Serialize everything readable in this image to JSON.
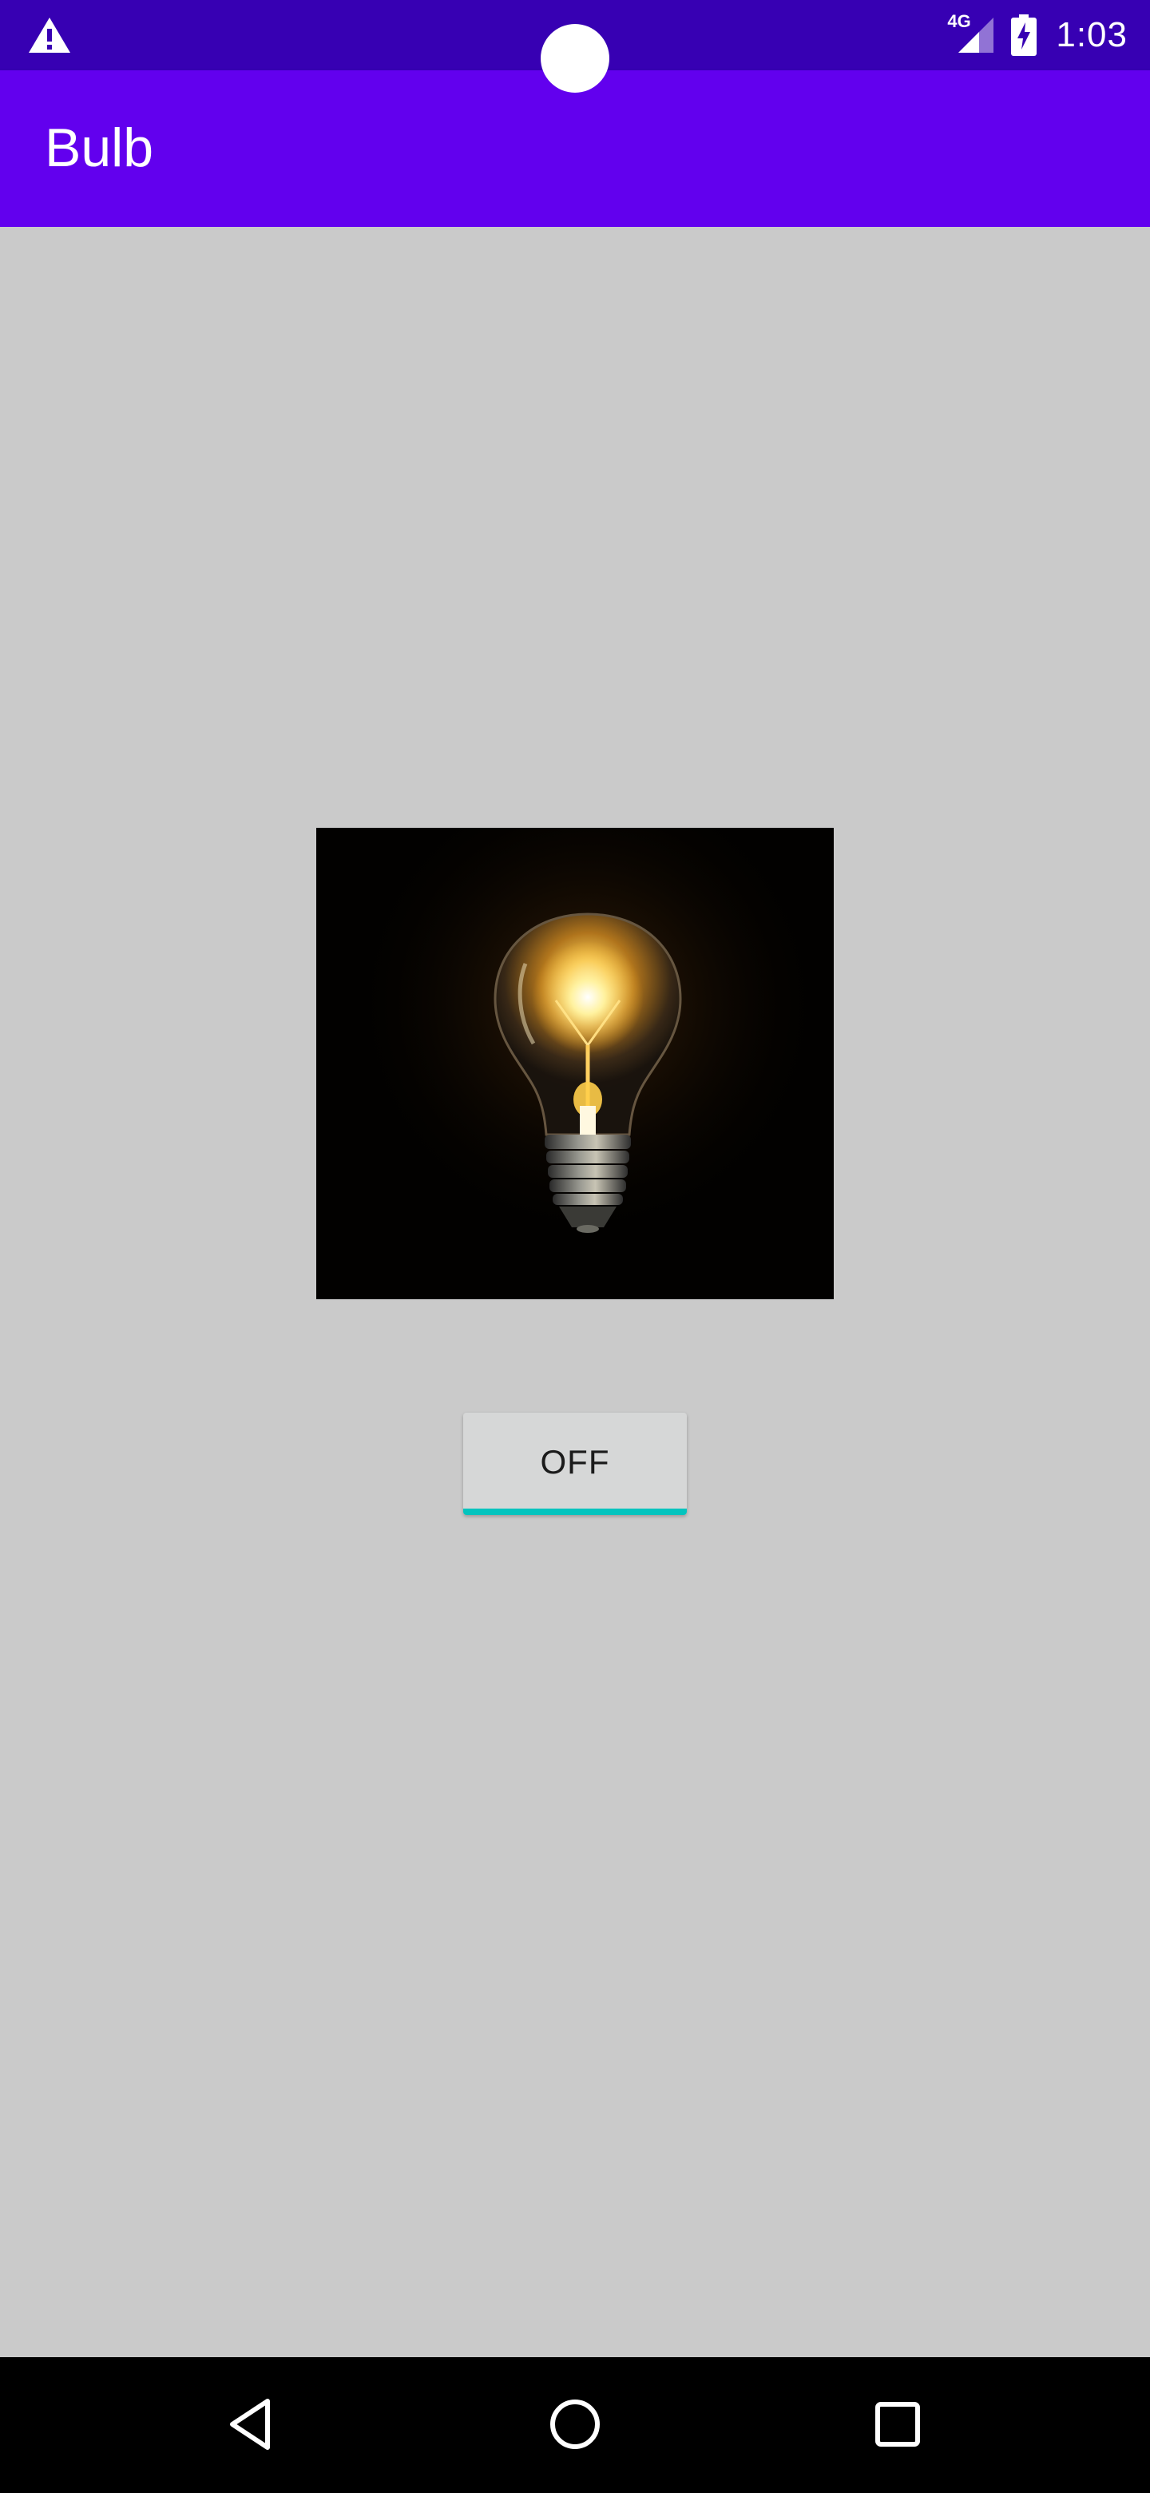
{
  "status_bar": {
    "time": "1:03",
    "network_label": "4G",
    "icons": [
      "warning-icon",
      "signal-icon",
      "battery-charging-icon"
    ]
  },
  "app_bar": {
    "title": "Bulb"
  },
  "main": {
    "bulb_image": {
      "icon": "light-bulb-image",
      "state": "on"
    },
    "toggle_button": {
      "label": "OFF",
      "accent_color": "#03c4be"
    }
  },
  "nav_bar": {
    "icons": [
      "back-icon",
      "home-icon",
      "recents-icon"
    ]
  },
  "colors": {
    "status_bar": "#3700b3",
    "app_bar": "#6200ee",
    "background": "#cacaca",
    "button": "#d6d7d7"
  }
}
